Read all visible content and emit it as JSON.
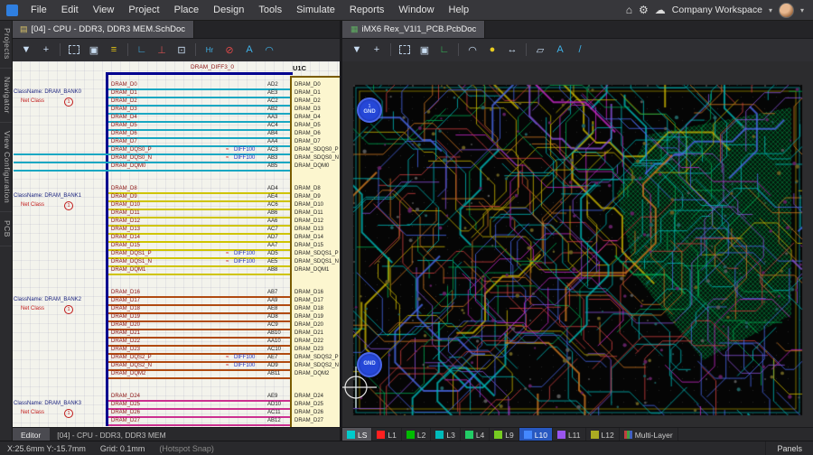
{
  "menubar": {
    "items": [
      "File",
      "Edit",
      "View",
      "Project",
      "Place",
      "Design",
      "Tools",
      "Simulate",
      "Reports",
      "Window",
      "Help"
    ],
    "home_icon": "⌂",
    "settings_icon": "⚙",
    "cloud_icon": "☁",
    "workspace_label": "Company Workspace",
    "caret": "▾"
  },
  "left_pane": {
    "tab": {
      "title": "[04] - CPU - DDR3, DDR3 MEM.SchDoc",
      "icon": "▤"
    },
    "side_tabs": [
      "Projects",
      "Navigator",
      "View Configuration",
      "PCB"
    ],
    "toolbar_icons": [
      {
        "name": "filter-icon",
        "glyph": "▼",
        "color": "#c9ddf2"
      },
      {
        "name": "move-icon",
        "glyph": "+",
        "color": "#c9ddf2"
      },
      {
        "name": "select-area-icon",
        "type": "dashed"
      },
      {
        "name": "copy-icon",
        "glyph": "▣",
        "color": "#c9ddf2"
      },
      {
        "name": "align-icon",
        "glyph": "≡",
        "color": "#e3c414"
      },
      {
        "name": "wire-icon",
        "glyph": "∟",
        "color": "#3fb2e8"
      },
      {
        "name": "gnd-icon",
        "glyph": "⊥",
        "color": "#d05050"
      },
      {
        "name": "part-icon",
        "glyph": "⊡",
        "color": "#c9ddf2"
      },
      {
        "name": "harness-icon",
        "glyph": "Hr",
        "color": "#3fb2e8"
      },
      {
        "name": "no-erc-icon",
        "glyph": "⊘",
        "color": "#e04848"
      },
      {
        "name": "text-icon",
        "glyph": "A",
        "color": "#3fb2e8"
      },
      {
        "name": "arc-icon",
        "glyph": "◠",
        "color": "#3fb2e8"
      }
    ],
    "schematic": {
      "sheet_label": "DRAM_DIFF3_0",
      "component_ref": "U1C",
      "diff_label": "DIFF100",
      "banks": [
        {
          "class_name": "ClassName: DRAM_BANK0",
          "net_label": "Net Class",
          "badge": "1",
          "color": "#1aa7c2",
          "rows": [
            {
              "net": "DRAM_D0",
              "pin": "AD2",
              "comp": "DRAM_D0"
            },
            {
              "net": "DRAM_D1",
              "pin": "AE3",
              "comp": "DRAM_D1"
            },
            {
              "net": "DRAM_D2",
              "pin": "AC2",
              "comp": "DRAM_D2"
            },
            {
              "net": "DRAM_D3",
              "pin": "AB2",
              "comp": "DRAM_D3"
            },
            {
              "net": "DRAM_D4",
              "pin": "AA3",
              "comp": "DRAM_D4"
            },
            {
              "net": "DRAM_D5",
              "pin": "AC4",
              "comp": "DRAM_D5"
            },
            {
              "net": "DRAM_D6",
              "pin": "AB4",
              "comp": "DRAM_D6"
            },
            {
              "net": "DRAM_D7",
              "pin": "AA4",
              "comp": "DRAM_D7"
            },
            {
              "net": "DRAM_DQS0_P",
              "pin": "AC3",
              "comp": "DRAM_SDQS0_P",
              "dqs": true,
              "long": true
            },
            {
              "net": "DRAM_DQS0_N",
              "pin": "AB3",
              "comp": "DRAM_SDQS0_N",
              "dqs": true,
              "long": true
            },
            {
              "net": "DRAM_DQM0",
              "pin": "AB5",
              "comp": "DRAM_DQM0",
              "long": true
            }
          ]
        },
        {
          "class_name": "ClassName: DRAM_BANK1",
          "net_label": "Net Class",
          "badge": "1",
          "color": "#cfc400",
          "rows": [
            {
              "net": "DRAM_D8",
              "pin": "AD4",
              "comp": "DRAM_D8"
            },
            {
              "net": "DRAM_D9",
              "pin": "AE4",
              "comp": "DRAM_D9"
            },
            {
              "net": "DRAM_D10",
              "pin": "AC6",
              "comp": "DRAM_D10"
            },
            {
              "net": "DRAM_D11",
              "pin": "AB6",
              "comp": "DRAM_D11"
            },
            {
              "net": "DRAM_D12",
              "pin": "AA6",
              "comp": "DRAM_D12"
            },
            {
              "net": "DRAM_D13",
              "pin": "AC7",
              "comp": "DRAM_D13"
            },
            {
              "net": "DRAM_D14",
              "pin": "AD7",
              "comp": "DRAM_D14"
            },
            {
              "net": "DRAM_D15",
              "pin": "AA7",
              "comp": "DRAM_D15"
            },
            {
              "net": "DRAM_DQS1_P",
              "pin": "AD5",
              "comp": "DRAM_SDQS1_P",
              "dqs": true
            },
            {
              "net": "DRAM_DQS1_N",
              "pin": "AE5",
              "comp": "DRAM_SDQS1_N",
              "dqs": true
            },
            {
              "net": "DRAM_DQM1",
              "pin": "AB8",
              "comp": "DRAM_DQM1"
            }
          ]
        },
        {
          "class_name": "ClassName: DRAM_BANK2",
          "net_label": "Net Class",
          "badge": "1",
          "color": "#b04a10",
          "rows": [
            {
              "net": "DRAM_D16",
              "pin": "AB7",
              "comp": "DRAM_D16"
            },
            {
              "net": "DRAM_D17",
              "pin": "AA9",
              "comp": "DRAM_D17"
            },
            {
              "net": "DRAM_D18",
              "pin": "AE8",
              "comp": "DRAM_D18"
            },
            {
              "net": "DRAM_D19",
              "pin": "AD8",
              "comp": "DRAM_D19"
            },
            {
              "net": "DRAM_D20",
              "pin": "AC9",
              "comp": "DRAM_D20"
            },
            {
              "net": "DRAM_D21",
              "pin": "AB10",
              "comp": "DRAM_D21"
            },
            {
              "net": "DRAM_D22",
              "pin": "AA10",
              "comp": "DRAM_D22"
            },
            {
              "net": "DRAM_D23",
              "pin": "AC10",
              "comp": "DRAM_D23"
            },
            {
              "net": "DRAM_DQS2_P",
              "pin": "AE7",
              "comp": "DRAM_SDQS2_P",
              "dqs": true
            },
            {
              "net": "DRAM_DQS2_N",
              "pin": "AD9",
              "comp": "DRAM_SDQS2_N",
              "dqs": true
            },
            {
              "net": "DRAM_DQM2",
              "pin": "AB11",
              "comp": "DRAM_DQM2"
            }
          ]
        },
        {
          "class_name": "ClassName: DRAM_BANK3",
          "net_label": "Net Class",
          "badge": "1",
          "color": "#cc3090",
          "rows": [
            {
              "net": "DRAM_D24",
              "pin": "AE9",
              "comp": "DRAM_D24"
            },
            {
              "net": "DRAM_D25",
              "pin": "AD10",
              "comp": "DRAM_D25"
            },
            {
              "net": "DRAM_D26",
              "pin": "AC11",
              "comp": "DRAM_D26"
            },
            {
              "net": "DRAM_D27",
              "pin": "AB12",
              "comp": "DRAM_D27"
            }
          ]
        }
      ]
    },
    "bottom": {
      "editor_tab": "Editor",
      "doc_label": "[04] - CPU - DDR3, DDR3 MEM"
    }
  },
  "right_pane": {
    "tab": {
      "title": "iMX6 Rex_V1I1_PCB.PcbDoc",
      "icon": "▦"
    },
    "toolbar_icons": [
      {
        "name": "filter-icon",
        "glyph": "▼",
        "color": "#c9ddf2"
      },
      {
        "name": "move-icon",
        "glyph": "+",
        "color": "#c9ddf2"
      },
      {
        "name": "select-area-icon",
        "type": "dashed"
      },
      {
        "name": "union-icon",
        "glyph": "▣",
        "color": "#c9ddf2"
      },
      {
        "name": "route-icon",
        "glyph": "∟",
        "color": "#35c05a"
      },
      {
        "name": "arc-icon",
        "glyph": "◠",
        "color": "#c9ddf2"
      },
      {
        "name": "highlight-bulb-icon",
        "glyph": "●",
        "color": "#e8cc20"
      },
      {
        "name": "measure-icon",
        "glyph": "↔",
        "color": "#c9ddf2"
      },
      {
        "name": "polygon-icon",
        "glyph": "▱",
        "color": "#c9ddf2"
      },
      {
        "name": "text-icon",
        "glyph": "A",
        "color": "#3fb2e8"
      },
      {
        "name": "line-icon",
        "glyph": "/",
        "color": "#3fb2e8"
      }
    ],
    "pcb": {
      "gnd_top_num": "1",
      "gnd_top": "GND",
      "gnd_bottom": "GND",
      "board_bg": "#050505",
      "margin_bg": "#2c2c2e",
      "polygon_color": "#00a050",
      "trace_colors": [
        "#00b6b6",
        "#c8b400",
        "#c828c8",
        "#d04040",
        "#00a650",
        "#d07820",
        "#4868e8",
        "#8850d8"
      ]
    },
    "layers": {
      "tabs": [
        {
          "label": "LS",
          "color": "#00cccc",
          "state": "selected"
        },
        {
          "label": "L1",
          "color": "#ff2020"
        },
        {
          "label": "L2",
          "color": "#00bb00"
        },
        {
          "label": "L3",
          "color": "#00bbbb"
        },
        {
          "label": "L4",
          "color": "#22cc66"
        },
        {
          "label": "L9",
          "color": "#77cc22"
        },
        {
          "label": "L10",
          "color": "#4488ff",
          "state": "current"
        },
        {
          "label": "L11",
          "color": "#9955ee"
        },
        {
          "label": "L12",
          "color": "#aaaa22"
        },
        {
          "label": "Multi-Layer",
          "color": "multi"
        }
      ]
    }
  },
  "statusbar": {
    "coords": "X:25.6mm Y:-15.7mm",
    "grid": "Grid: 0.1mm",
    "snap": "(Hotspot Snap)",
    "panels": "Panels"
  }
}
